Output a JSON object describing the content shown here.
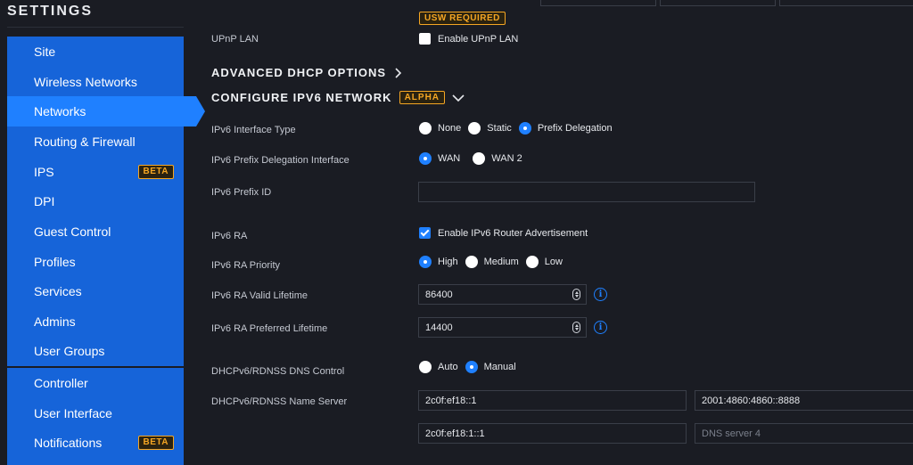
{
  "sidebar": {
    "title": "SETTINGS",
    "group1": [
      {
        "label": "Site",
        "badge": ""
      },
      {
        "label": "Wireless Networks",
        "badge": ""
      },
      {
        "label": "Networks",
        "badge": "",
        "active": true
      },
      {
        "label": "Routing & Firewall",
        "badge": ""
      },
      {
        "label": "IPS",
        "badge": "BETA"
      },
      {
        "label": "DPI",
        "badge": ""
      },
      {
        "label": "Guest Control",
        "badge": ""
      },
      {
        "label": "Profiles",
        "badge": ""
      },
      {
        "label": "Services",
        "badge": ""
      },
      {
        "label": "Admins",
        "badge": ""
      },
      {
        "label": "User Groups",
        "badge": ""
      }
    ],
    "group2": [
      {
        "label": "Controller",
        "badge": ""
      },
      {
        "label": "User Interface",
        "badge": ""
      },
      {
        "label": "Notifications",
        "badge": "BETA"
      }
    ]
  },
  "main": {
    "usw_required": "USW REQUIRED",
    "upnp": {
      "label": "UPnP LAN",
      "checkbox_label": "Enable UPnP LAN",
      "checked": false
    },
    "advanced_dhcp": "ADVANCED DHCP OPTIONS",
    "ipv6_section": "CONFIGURE IPV6 NETWORK",
    "alpha_badge": "ALPHA",
    "ipv6_interface_type": {
      "label": "IPv6 Interface Type",
      "options": [
        "None",
        "Static",
        "Prefix Delegation"
      ],
      "selected": "Prefix Delegation"
    },
    "ipv6_pd_interface": {
      "label": "IPv6 Prefix Delegation Interface",
      "options": [
        "WAN",
        "WAN 2"
      ],
      "selected": "WAN"
    },
    "ipv6_prefix_id": {
      "label": "IPv6 Prefix ID",
      "value": ""
    },
    "ipv6_ra": {
      "label": "IPv6 RA",
      "checkbox_label": "Enable IPv6 Router Advertisement",
      "checked": true
    },
    "ipv6_ra_priority": {
      "label": "IPv6 RA Priority",
      "options": [
        "High",
        "Medium",
        "Low"
      ],
      "selected": "High"
    },
    "ipv6_ra_valid": {
      "label": "IPv6 RA Valid Lifetime",
      "value": "86400"
    },
    "ipv6_ra_preferred": {
      "label": "IPv6 RA Preferred Lifetime",
      "value": "14400"
    },
    "dns_control": {
      "label": "DHCPv6/RDNSS DNS Control",
      "options": [
        "Auto",
        "Manual"
      ],
      "selected": "Manual"
    },
    "name_server": {
      "label": "DHCPv6/RDNSS Name Server",
      "dns1": "2c0f:ef18::1",
      "dns2": "2001:4860:4860::8888",
      "dns3": "2c0f:ef18:1::1",
      "dns4_placeholder": "DNS server 4"
    }
  },
  "colors": {
    "accent": "#1f80ff",
    "sidebar_blue": "#1664d9",
    "badge_orange": "#f5a623",
    "background": "#1a1c23"
  },
  "icons": {
    "info": "info-icon",
    "chevron_right": "chevron-right-icon",
    "chevron_down": "chevron-down-icon"
  }
}
